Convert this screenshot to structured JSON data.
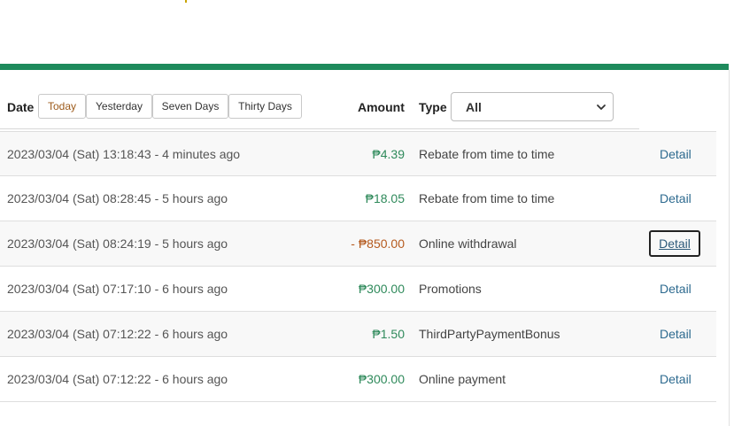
{
  "header": {
    "date_label": "Date",
    "filters": [
      {
        "label": "Today",
        "active": true
      },
      {
        "label": "Yesterday",
        "active": false
      },
      {
        "label": "Seven Days",
        "active": false
      },
      {
        "label": "Thirty Days",
        "active": false
      }
    ],
    "amount_label": "Amount",
    "type_label": "Type",
    "type_select_value": "All",
    "type_select_icon": "chevron-down-icon"
  },
  "colors": {
    "accent_green": "#1e8a5c",
    "positive_amount": "#2f8a5b",
    "negative_amount": "#b55a1e",
    "link": "#2d6a8f"
  },
  "rows": [
    {
      "time": "2023/03/04 (Sat) 13:18:43 - 4 minutes ago",
      "amount": "₱4.39",
      "sign": "pos",
      "type": "Rebate from time to time",
      "detail": "Detail"
    },
    {
      "time": "2023/03/04 (Sat) 08:28:45 - 5 hours ago",
      "amount": "₱18.05",
      "sign": "pos",
      "type": "Rebate from time to time",
      "detail": "Detail"
    },
    {
      "time": "2023/03/04 (Sat) 08:24:19 - 5 hours ago",
      "amount": "- ₱850.00",
      "sign": "neg",
      "type": "Online withdrawal",
      "detail": "Detail"
    },
    {
      "time": "2023/03/04 (Sat) 07:17:10 - 6 hours ago",
      "amount": "₱300.00",
      "sign": "pos",
      "type": "Promotions",
      "detail": "Detail"
    },
    {
      "time": "2023/03/04 (Sat) 07:12:22 - 6 hours ago",
      "amount": "₱1.50",
      "sign": "pos",
      "type": "ThirdPartyPaymentBonus",
      "detail": "Detail"
    },
    {
      "time": "2023/03/04 (Sat) 07:12:22 - 6 hours ago",
      "amount": "₱300.00",
      "sign": "pos",
      "type": "Online payment",
      "detail": "Detail"
    }
  ]
}
